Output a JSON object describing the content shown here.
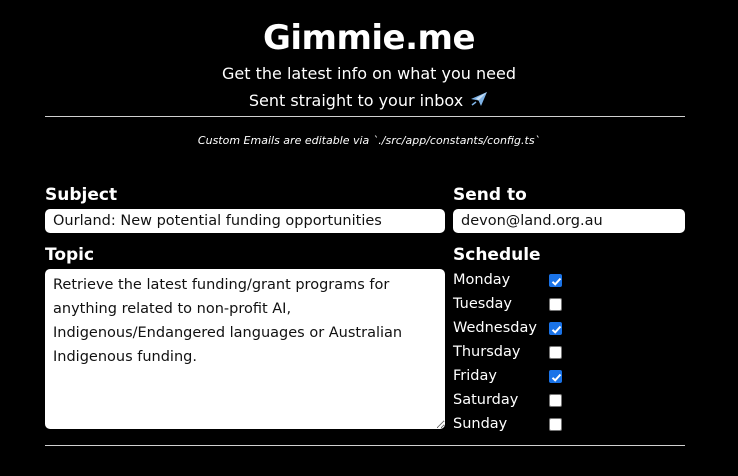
{
  "header": {
    "title": "Gimmie.me",
    "tagline": "Get the latest info on what you need",
    "tagline2": "Sent straight to your inbox",
    "tagline2_icon": "airplane-icon",
    "config_note": "Custom Emails are editable via `./src/app/constants/config.ts`"
  },
  "form": {
    "subject": {
      "label": "Subject",
      "value": "Ourland: New potential funding opportunities"
    },
    "send_to": {
      "label": "Send to",
      "value": "devon@land.org.au"
    },
    "topic": {
      "label": "Topic",
      "value": "Retrieve the latest funding/grant programs for anything related to non-profit AI, Indigenous/Endangered languages or Australian Indigenous funding."
    },
    "schedule": {
      "label": "Schedule",
      "days": [
        {
          "label": "Monday",
          "checked": true
        },
        {
          "label": "Tuesday",
          "checked": false
        },
        {
          "label": "Wednesday",
          "checked": true
        },
        {
          "label": "Thursday",
          "checked": false
        },
        {
          "label": "Friday",
          "checked": true
        },
        {
          "label": "Saturday",
          "checked": false
        },
        {
          "label": "Sunday",
          "checked": false
        }
      ]
    }
  },
  "colors": {
    "background": "#000000",
    "text": "#ffffff",
    "checkbox_checked": "#1a73e8"
  }
}
